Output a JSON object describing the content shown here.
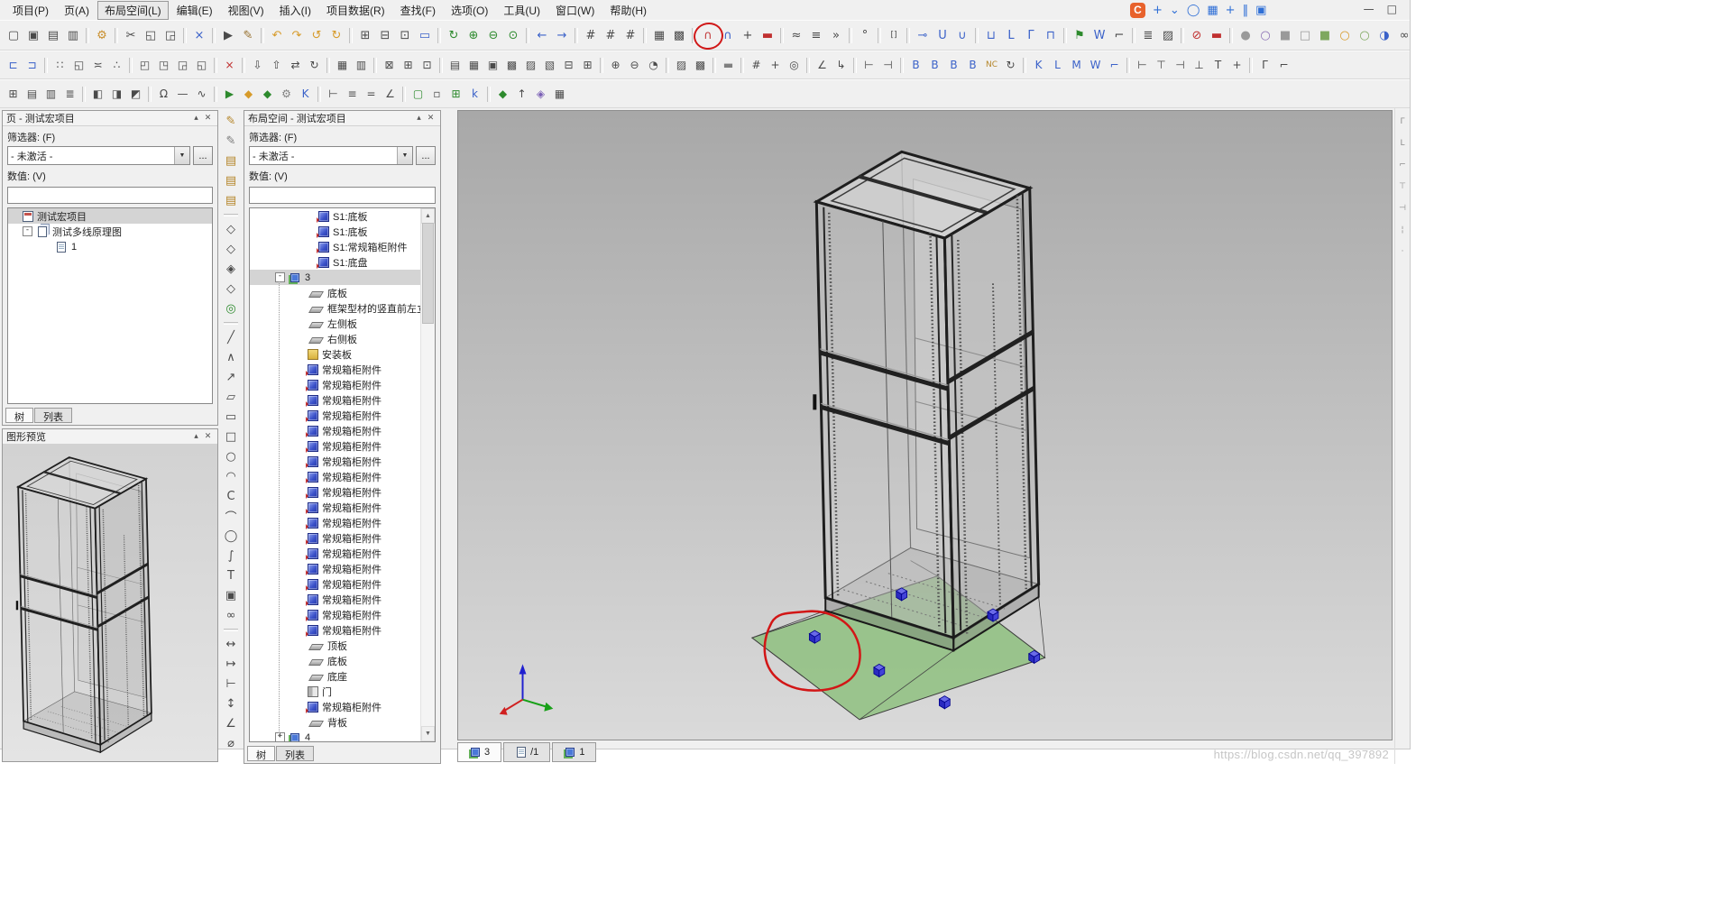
{
  "menubar": {
    "items": [
      {
        "label": "项目(P)"
      },
      {
        "label": "页(A)"
      },
      {
        "label": "布局空间(L)",
        "active": true
      },
      {
        "label": "编辑(E)"
      },
      {
        "label": "视图(V)"
      },
      {
        "label": "插入(I)"
      },
      {
        "label": "项目数据(R)"
      },
      {
        "label": "查找(F)"
      },
      {
        "label": "选项(O)"
      },
      {
        "label": "工具(U)"
      },
      {
        "label": "窗口(W)"
      },
      {
        "label": "帮助(H)"
      }
    ]
  },
  "window": {
    "minimize": "—",
    "maximize": "□"
  },
  "overlay": {
    "logo": "C",
    "icons": [
      {
        "n": "overlay-add",
        "g": "+"
      },
      {
        "n": "overlay-chevron",
        "g": "⌄"
      },
      {
        "n": "overlay-circle",
        "g": "◯"
      },
      {
        "n": "overlay-grid",
        "g": "▦"
      },
      {
        "n": "overlay-plus2",
        "g": "+"
      },
      {
        "n": "overlay-divider",
        "g": "‖"
      },
      {
        "n": "overlay-panel",
        "g": "▣"
      }
    ]
  },
  "toolbar1": [
    {
      "n": "new",
      "g": "▢"
    },
    {
      "n": "new-project",
      "g": "▣"
    },
    {
      "n": "open",
      "g": "▤"
    },
    {
      "n": "print",
      "g": "▥"
    },
    {
      "s": 1
    },
    {
      "n": "settings-wrench",
      "g": "⚙",
      "c": "#c98f2d"
    },
    {
      "s": 1
    },
    {
      "n": "cut",
      "g": "✂"
    },
    {
      "n": "copy",
      "g": "◱"
    },
    {
      "n": "paste",
      "g": "◲"
    },
    {
      "s": 1
    },
    {
      "n": "delete",
      "g": "×",
      "c": "#3b62c9"
    },
    {
      "s": 1
    },
    {
      "n": "select",
      "g": "▶"
    },
    {
      "n": "edit-pen",
      "g": "✎",
      "c": "#97712f"
    },
    {
      "s": 1
    },
    {
      "n": "undo",
      "g": "↶",
      "c": "#d79b2a"
    },
    {
      "n": "redo",
      "g": "↷",
      "c": "#d79b2a"
    },
    {
      "n": "undo-list",
      "g": "↺",
      "c": "#d79b2a"
    },
    {
      "n": "redo-list",
      "g": "↻",
      "c": "#d79b2a"
    },
    {
      "s": 1
    },
    {
      "n": "grid-table",
      "g": "⊞"
    },
    {
      "n": "grid-table-2",
      "g": "⊟"
    },
    {
      "n": "grid-table-3",
      "g": "⊡"
    },
    {
      "n": "workspace-monitor",
      "g": "▭",
      "c": "#3b62c9"
    },
    {
      "s": 1
    },
    {
      "n": "zoom-refresh",
      "g": "↻",
      "c": "#2d8a2d"
    },
    {
      "n": "zoom-in",
      "g": "⊕",
      "c": "#2d8a2d"
    },
    {
      "n": "zoom-out",
      "g": "⊖",
      "c": "#2d8a2d"
    },
    {
      "n": "zoom-window",
      "g": "⊙",
      "c": "#2d8a2d"
    },
    {
      "s": 1
    },
    {
      "n": "back",
      "g": "←",
      "c": "#3b62c9"
    },
    {
      "n": "forward",
      "g": "→",
      "c": "#3b62c9"
    },
    {
      "s": 1
    },
    {
      "n": "snap-grid-a",
      "g": "#"
    },
    {
      "n": "snap-grid-b",
      "g": "#"
    },
    {
      "n": "snap-grid-c",
      "g": "#"
    },
    {
      "s": 1
    },
    {
      "n": "grid-display",
      "g": "▦"
    },
    {
      "n": "grid-snap",
      "g": "▩"
    },
    {
      "s": 1
    },
    {
      "n": "snap-magnet",
      "g": "∩",
      "c": "#c23a3a",
      "circled": true
    },
    {
      "n": "object-snap",
      "g": "∩",
      "c": "#3b62c9"
    },
    {
      "n": "snap-point",
      "g": "+"
    },
    {
      "n": "logic-line-red",
      "g": "▬",
      "c": "#c03030"
    },
    {
      "s": 1
    },
    {
      "n": "align-wave",
      "g": "≈"
    },
    {
      "n": "align-lines",
      "g": "≡"
    },
    {
      "n": "align-arrows",
      "g": "»"
    },
    {
      "s": 1
    },
    {
      "n": "angle-tool",
      "g": "°"
    },
    {
      "s": 1
    },
    {
      "n": "brackets",
      "g": "[]"
    },
    {
      "s": 1
    },
    {
      "n": "conn-end-left",
      "g": "⊸",
      "c": "#3b62c9"
    },
    {
      "n": "conn-u",
      "g": "U",
      "c": "#3b62c9"
    },
    {
      "n": "conn-end-right",
      "g": "∪",
      "c": "#3b62c9"
    },
    {
      "s": 1
    },
    {
      "n": "corner-bl",
      "g": "⊔",
      "c": "#3b62c9"
    },
    {
      "n": "corner-l",
      "g": "L",
      "c": "#3b62c9"
    },
    {
      "n": "corner-r",
      "g": "Γ",
      "c": "#3b62c9"
    },
    {
      "n": "corner-top",
      "g": "⊓",
      "c": "#3b62c9"
    },
    {
      "s": 1
    },
    {
      "n": "placement-flag",
      "g": "⚑",
      "c": "#2d8a2d"
    },
    {
      "n": "w-tool",
      "g": "W",
      "c": "#3b62c9"
    },
    {
      "n": "corner-angle",
      "g": "⌐"
    },
    {
      "s": 1
    },
    {
      "n": "numbering",
      "g": "≣"
    },
    {
      "n": "hatch",
      "g": "▨"
    },
    {
      "s": 1
    },
    {
      "n": "forbid",
      "g": "⊘",
      "c": "#c03030"
    },
    {
      "n": "red-line",
      "g": "▬",
      "c": "#c03030"
    },
    {
      "s": 1
    },
    {
      "n": "shade-sphere",
      "g": "●",
      "c": "#9a9a9a"
    },
    {
      "n": "shade-wire",
      "g": "○",
      "c": "#8a6fb5"
    },
    {
      "n": "shade-box",
      "g": "■",
      "c": "#9a9a9a"
    },
    {
      "n": "shade-box-wire",
      "g": "□",
      "c": "#9a9a9a"
    },
    {
      "n": "shade-green",
      "g": "■",
      "c": "#7ea85e"
    },
    {
      "n": "shade-orange",
      "g": "○",
      "c": "#d79b2a"
    },
    {
      "n": "shade-green-2",
      "g": "○",
      "c": "#7ea85e"
    },
    {
      "n": "shade-blue",
      "g": "◑",
      "c": "#3b62c9"
    },
    {
      "n": "link-chain",
      "g": "∞"
    }
  ],
  "toolbar2": [
    {
      "n": "dock-left",
      "g": "⊏",
      "c": "#3b62c9"
    },
    {
      "n": "dock-right",
      "g": "⊐",
      "c": "#3b62c9"
    },
    {
      "s": 1
    },
    {
      "n": "window-tile",
      "g": "∷"
    },
    {
      "n": "window-cascade",
      "g": "◱"
    },
    {
      "n": "window-arrange",
      "g": "≍"
    },
    {
      "n": "window-group",
      "g": "∴"
    },
    {
      "s": 1
    },
    {
      "n": "page-copy",
      "g": "◰"
    },
    {
      "n": "page-new",
      "g": "◳"
    },
    {
      "n": "page-open",
      "g": "◲"
    },
    {
      "n": "page-properties",
      "g": "◱"
    },
    {
      "s": 1
    },
    {
      "n": "delete-page",
      "g": "×",
      "c": "#c03030"
    },
    {
      "s": 1
    },
    {
      "n": "import",
      "g": "⇩"
    },
    {
      "n": "export",
      "g": "⇧"
    },
    {
      "n": "swap",
      "g": "⇄"
    },
    {
      "n": "reload",
      "g": "↻"
    },
    {
      "s": 1
    },
    {
      "n": "frame-grid",
      "g": "▦"
    },
    {
      "n": "frame-rows",
      "g": "▥"
    },
    {
      "s": 1
    },
    {
      "n": "box-select",
      "g": "⊠"
    },
    {
      "n": "box-add",
      "g": "⊞"
    },
    {
      "n": "box-properties",
      "g": "⊡"
    },
    {
      "s": 1
    },
    {
      "n": "table-a",
      "g": "▤"
    },
    {
      "n": "table-b",
      "g": "▦"
    },
    {
      "n": "table-c",
      "g": "▣"
    },
    {
      "n": "table-d",
      "g": "▩"
    },
    {
      "n": "table-e",
      "g": "▨"
    },
    {
      "n": "table-f",
      "g": "▧"
    },
    {
      "n": "table-g",
      "g": "⊟"
    },
    {
      "n": "table-h",
      "g": "⊞"
    },
    {
      "s": 1
    },
    {
      "n": "time-plus",
      "g": "⊕"
    },
    {
      "n": "time-minus",
      "g": "⊖"
    },
    {
      "n": "time",
      "g": "◔"
    },
    {
      "s": 1
    },
    {
      "n": "hatch-fill",
      "g": "▨"
    },
    {
      "n": "solid-fill",
      "g": "▩"
    },
    {
      "s": 1
    },
    {
      "n": "block",
      "g": "▬",
      "c": "#808080"
    },
    {
      "s": 1
    },
    {
      "n": "grid-ref",
      "g": "#"
    },
    {
      "n": "snap-center",
      "g": "+"
    },
    {
      "n": "target",
      "g": "◎"
    },
    {
      "s": 1
    },
    {
      "n": "dim-angle",
      "g": "∠"
    },
    {
      "n": "dim-leader",
      "g": "↳"
    },
    {
      "s": 1
    },
    {
      "n": "trim",
      "g": "⊢"
    },
    {
      "n": "extend",
      "g": "⊣"
    },
    {
      "s": 1
    },
    {
      "n": "device-b1",
      "g": "B",
      "c": "#3b62c9"
    },
    {
      "n": "device-b2",
      "g": "B",
      "c": "#3b62c9"
    },
    {
      "n": "device-b3",
      "g": "B",
      "c": "#3b62c9"
    },
    {
      "n": "device-b4",
      "g": "B",
      "c": "#3b62c9"
    },
    {
      "n": "device-nc",
      "g": "NC",
      "c": "#b5862a"
    },
    {
      "n": "device-reload",
      "g": "↻"
    },
    {
      "s": 1
    },
    {
      "n": "k-tool",
      "g": "K",
      "c": "#3b62c9"
    },
    {
      "n": "l-tool",
      "g": "L",
      "c": "#3b62c9"
    },
    {
      "n": "m-tool",
      "g": "M",
      "c": "#3b62c9"
    },
    {
      "n": "w-tool-2",
      "g": "W",
      "c": "#3b62c9"
    },
    {
      "n": "corner-tool",
      "g": "⌐",
      "c": "#3b62c9"
    },
    {
      "s": 1
    },
    {
      "n": "dim-left",
      "g": "⊢"
    },
    {
      "n": "dim-top",
      "g": "⊤"
    },
    {
      "n": "dim-right",
      "g": "⊣"
    },
    {
      "n": "dim-bottom",
      "g": "⊥"
    },
    {
      "n": "dim-t",
      "g": "T"
    },
    {
      "n": "dim-plus",
      "g": "+"
    },
    {
      "s": 1
    },
    {
      "n": "frame-corner-1",
      "g": "Γ"
    },
    {
      "n": "frame-corner-2",
      "g": "⌐"
    }
  ],
  "toolbar3": [
    {
      "n": "workbook",
      "g": "⊞"
    },
    {
      "n": "sheet-view",
      "g": "▤"
    },
    {
      "n": "column-view",
      "g": "▥"
    },
    {
      "n": "list-view",
      "g": "≣"
    },
    {
      "s": 1
    },
    {
      "n": "pane-left",
      "g": "◧"
    },
    {
      "n": "pane-right",
      "g": "◨"
    },
    {
      "n": "pane-top",
      "g": "◩"
    },
    {
      "s": 1
    },
    {
      "n": "omega-symbol",
      "g": "Ω"
    },
    {
      "n": "dash-line",
      "g": "—"
    },
    {
      "n": "wave-line",
      "g": "∿"
    },
    {
      "s": 1
    },
    {
      "n": "run-macro",
      "g": "▶",
      "c": "#2d8a2d"
    },
    {
      "n": "macro-orange",
      "g": "◆",
      "c": "#d79b2a"
    },
    {
      "n": "macro-green",
      "g": "◆",
      "c": "#2d8a2d"
    },
    {
      "n": "tool-gear",
      "g": "⚙",
      "c": "#808080"
    },
    {
      "n": "tool-k",
      "g": "K",
      "c": "#3b62c9"
    },
    {
      "s": 1
    },
    {
      "n": "measure-left",
      "g": "⊢"
    },
    {
      "n": "measure-lines",
      "g": "≡"
    },
    {
      "n": "measure-equal",
      "g": "="
    },
    {
      "n": "measure-angle",
      "g": "∠"
    },
    {
      "s": 1
    },
    {
      "n": "box-green",
      "g": "▢",
      "c": "#2d8a2d"
    },
    {
      "n": "box-dashed",
      "g": "▫"
    },
    {
      "n": "grid-green",
      "g": "⊞",
      "c": "#2d8a2d"
    },
    {
      "n": "k-small",
      "g": "k",
      "c": "#3b62c9"
    },
    {
      "s": 1
    },
    {
      "n": "diamond-green",
      "g": "◆",
      "c": "#2d8a2d"
    },
    {
      "n": "nav-up",
      "g": "↑"
    },
    {
      "n": "diamond-multi",
      "g": "◈",
      "c": "#7a5fb5"
    },
    {
      "n": "hatch-small",
      "g": "▦"
    }
  ],
  "side_toolbar": [
    {
      "n": "layer-pen",
      "g": "✎",
      "c": "#b5862a"
    },
    {
      "n": "layer-pen-2",
      "g": "✎",
      "c": "#7a7a7a"
    },
    {
      "n": "layer-copy",
      "g": "▤",
      "c": "#b5862a"
    },
    {
      "n": "layer-stack",
      "g": "▤",
      "c": "#b5862a"
    },
    {
      "n": "layer-sheet",
      "g": "▤",
      "c": "#b5862a"
    },
    {
      "s": 1
    },
    {
      "n": "symbol-diamond-1",
      "g": "◇"
    },
    {
      "n": "symbol-diamond-2",
      "g": "◇"
    },
    {
      "n": "symbol-diamond-3",
      "g": "◈"
    },
    {
      "n": "symbol-diamond-4",
      "g": "◇"
    },
    {
      "n": "connection-point",
      "g": "◎",
      "c": "#2d8a2d"
    },
    {
      "s": 1
    },
    {
      "n": "draw-line",
      "g": "╱"
    },
    {
      "n": "draw-polyline",
      "g": "∧"
    },
    {
      "n": "draw-line-arrow",
      "g": "↗"
    },
    {
      "n": "draw-polygon",
      "g": "▱"
    },
    {
      "n": "draw-rectangle",
      "g": "▭"
    },
    {
      "n": "draw-rect-2",
      "g": "□"
    },
    {
      "n": "draw-circle",
      "g": "○"
    },
    {
      "n": "draw-arc",
      "g": "◠"
    },
    {
      "n": "draw-arc-2",
      "g": "C"
    },
    {
      "n": "draw-arc-3",
      "g": "⌒"
    },
    {
      "n": "draw-ellipse",
      "g": "◯"
    },
    {
      "n": "draw-spline",
      "g": "∫"
    },
    {
      "n": "draw-text",
      "g": "T"
    },
    {
      "n": "draw-image",
      "g": "▣"
    },
    {
      "n": "draw-link",
      "g": "∞"
    },
    {
      "s": 1
    },
    {
      "n": "dim-linear",
      "g": "↔"
    },
    {
      "n": "dim-continue",
      "g": "↦"
    },
    {
      "n": "dim-baseline",
      "g": "⊢"
    },
    {
      "n": "dim-vertical",
      "g": "↕"
    },
    {
      "n": "dim-angle-tool",
      "g": "∠"
    },
    {
      "n": "dim-diameter",
      "g": "⌀"
    }
  ],
  "right_toolbar": [
    {
      "n": "right-tool-1",
      "g": "Γ"
    },
    {
      "n": "right-tool-2",
      "g": "L"
    },
    {
      "n": "right-tool-3",
      "g": "⌐"
    },
    {
      "n": "right-tool-4",
      "g": "⊤"
    },
    {
      "n": "right-tool-5",
      "g": "⊣"
    },
    {
      "n": "right-tool-6",
      "g": "¦"
    },
    {
      "n": "right-tool-7",
      "g": "·"
    }
  ],
  "pages_panel": {
    "title": "页 - 测试宏项目",
    "pin": "▴",
    "close": "✕",
    "filter_label": "筛选器: (F)",
    "filter_value": "- 未激活 -",
    "browse": "...",
    "value_label": "数值: (V)",
    "value_text": "",
    "tabs": [
      {
        "label": "树",
        "active": true
      },
      {
        "label": "列表"
      }
    ],
    "tree": [
      {
        "label": "测试宏项目",
        "lvl": 1,
        "icon": "project",
        "sel": true
      },
      {
        "label": "测试多线原理图",
        "lvl": 1,
        "icon": "pages",
        "expand": "minus"
      },
      {
        "label": "1",
        "lvl": 4,
        "icon": "page"
      }
    ]
  },
  "preview_panel": {
    "title": "图形预览",
    "pin": "▴",
    "close": "✕"
  },
  "layout_panel": {
    "title": "布局空间 - 测试宏项目",
    "pin": "▴",
    "close": "✕",
    "filter_label": "筛选器: (F)",
    "filter_value": "- 未激活 -",
    "browse": "...",
    "value_label": "数值: (V)",
    "value_text": "",
    "tabs": [
      {
        "label": "树",
        "active": true
      },
      {
        "label": "列表"
      }
    ],
    "tree": [
      {
        "label": "S1:底板",
        "lvl": 6,
        "icon": "part"
      },
      {
        "label": "S1:底板",
        "lvl": 6,
        "icon": "part"
      },
      {
        "label": "S1:常规箱柜附件",
        "lvl": 6,
        "icon": "part"
      },
      {
        "label": "S1:底盘",
        "lvl": 6,
        "icon": "part"
      },
      {
        "label": "3",
        "lvl": 2,
        "icon": "cube",
        "expand": "minus",
        "sel": true
      },
      {
        "label": "底板",
        "lvl": 5,
        "icon": "plate"
      },
      {
        "label": "框架型材的竖直前左立柱",
        "lvl": 5,
        "icon": "plate"
      },
      {
        "label": "左侧板",
        "lvl": 5,
        "icon": "plate"
      },
      {
        "label": "右侧板",
        "lvl": 5,
        "icon": "plate"
      },
      {
        "label": "安装板",
        "lvl": 5,
        "icon": "mount"
      },
      {
        "label": "常规箱柜附件",
        "lvl": 5,
        "icon": "part"
      },
      {
        "label": "常规箱柜附件",
        "lvl": 5,
        "icon": "part"
      },
      {
        "label": "常规箱柜附件",
        "lvl": 5,
        "icon": "part"
      },
      {
        "label": "常规箱柜附件",
        "lvl": 5,
        "icon": "part"
      },
      {
        "label": "常规箱柜附件",
        "lvl": 5,
        "icon": "part"
      },
      {
        "label": "常规箱柜附件",
        "lvl": 5,
        "icon": "part"
      },
      {
        "label": "常规箱柜附件",
        "lvl": 5,
        "icon": "part"
      },
      {
        "label": "常规箱柜附件",
        "lvl": 5,
        "icon": "part"
      },
      {
        "label": "常规箱柜附件",
        "lvl": 5,
        "icon": "part"
      },
      {
        "label": "常规箱柜附件",
        "lvl": 5,
        "icon": "part"
      },
      {
        "label": "常规箱柜附件",
        "lvl": 5,
        "icon": "part"
      },
      {
        "label": "常规箱柜附件",
        "lvl": 5,
        "icon": "part"
      },
      {
        "label": "常规箱柜附件",
        "lvl": 5,
        "icon": "part"
      },
      {
        "label": "常规箱柜附件",
        "lvl": 5,
        "icon": "part"
      },
      {
        "label": "常规箱柜附件",
        "lvl": 5,
        "icon": "part"
      },
      {
        "label": "常规箱柜附件",
        "lvl": 5,
        "icon": "part"
      },
      {
        "label": "常规箱柜附件",
        "lvl": 5,
        "icon": "part"
      },
      {
        "label": "常规箱柜附件",
        "lvl": 5,
        "icon": "part"
      },
      {
        "label": "顶板",
        "lvl": 5,
        "icon": "plate"
      },
      {
        "label": "底板",
        "lvl": 5,
        "icon": "plate"
      },
      {
        "label": "底座",
        "lvl": 5,
        "icon": "plate"
      },
      {
        "label": "门",
        "lvl": 5,
        "icon": "door"
      },
      {
        "label": "常规箱柜附件",
        "lvl": 5,
        "icon": "part"
      },
      {
        "label": "背板",
        "lvl": 5,
        "icon": "plate"
      },
      {
        "label": "4",
        "lvl": 2,
        "icon": "cube",
        "expand": "plus"
      }
    ]
  },
  "viewport": {
    "tabs": [
      {
        "label": "3",
        "icon": "cube",
        "active": true
      },
      {
        "label": "/1",
        "icon": "page"
      },
      {
        "label": "1",
        "icon": "cube"
      }
    ],
    "watermark": "https://blog.csdn.net/qq_397892"
  },
  "colors": {
    "accent_blue": "#3b62c9",
    "annotation_red": "#d01818",
    "plate_green": "#8cc07c",
    "handle_blue": "#2a2ac0"
  }
}
